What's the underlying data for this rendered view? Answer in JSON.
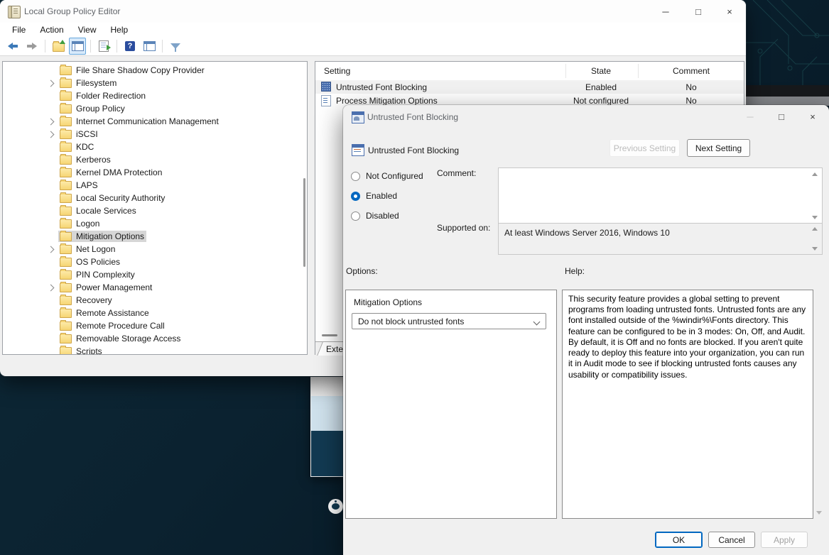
{
  "window": {
    "title": "Local Group Policy Editor",
    "menu": [
      "File",
      "Action",
      "View",
      "Help"
    ],
    "toolbar_icons": [
      "back",
      "forward",
      "up-one-level",
      "console-tree-active",
      "export-list",
      "help",
      "show-console",
      "filter"
    ],
    "tree": {
      "items": [
        {
          "label": "File Share Shadow Copy Provider",
          "expandable": false,
          "selected": false
        },
        {
          "label": "Filesystem",
          "expandable": true,
          "selected": false
        },
        {
          "label": "Folder Redirection",
          "expandable": false,
          "selected": false
        },
        {
          "label": "Group Policy",
          "expandable": false,
          "selected": false
        },
        {
          "label": "Internet Communication Management",
          "expandable": true,
          "selected": false
        },
        {
          "label": "iSCSI",
          "expandable": true,
          "selected": false
        },
        {
          "label": "KDC",
          "expandable": false,
          "selected": false
        },
        {
          "label": "Kerberos",
          "expandable": false,
          "selected": false
        },
        {
          "label": "Kernel DMA Protection",
          "expandable": false,
          "selected": false
        },
        {
          "label": "LAPS",
          "expandable": false,
          "selected": false
        },
        {
          "label": "Local Security Authority",
          "expandable": false,
          "selected": false
        },
        {
          "label": "Locale Services",
          "expandable": false,
          "selected": false
        },
        {
          "label": "Logon",
          "expandable": false,
          "selected": false
        },
        {
          "label": "Mitigation Options",
          "expandable": false,
          "selected": true
        },
        {
          "label": "Net Logon",
          "expandable": true,
          "selected": false
        },
        {
          "label": "OS Policies",
          "expandable": false,
          "selected": false
        },
        {
          "label": "PIN Complexity",
          "expandable": false,
          "selected": false
        },
        {
          "label": "Power Management",
          "expandable": true,
          "selected": false
        },
        {
          "label": "Recovery",
          "expandable": false,
          "selected": false
        },
        {
          "label": "Remote Assistance",
          "expandable": false,
          "selected": false
        },
        {
          "label": "Remote Procedure Call",
          "expandable": false,
          "selected": false
        },
        {
          "label": "Removable Storage Access",
          "expandable": false,
          "selected": false
        },
        {
          "label": "Scripts",
          "expandable": false,
          "selected": false
        }
      ]
    },
    "list": {
      "columns": [
        "Setting",
        "State",
        "Comment"
      ],
      "rows": [
        {
          "setting": "Untrusted Font Blocking",
          "state": "Enabled",
          "comment": "No",
          "icon": "admx-dotted",
          "highlighted": true
        },
        {
          "setting": "Process Mitigation Options",
          "state": "Not configured",
          "comment": "No",
          "icon": "list-doc",
          "highlighted": false
        }
      ],
      "bottom_tab": "Exter"
    }
  },
  "dialog": {
    "title": "Untrusted Font Blocking",
    "setting_name": "Untrusted Font Blocking",
    "previous_button": "Previous Setting",
    "next_button": "Next Setting",
    "radios": [
      {
        "label": "Not Configured",
        "selected": false
      },
      {
        "label": "Enabled",
        "selected": true
      },
      {
        "label": "Disabled",
        "selected": false
      }
    ],
    "comment_label": "Comment:",
    "comment_value": "",
    "supported_label": "Supported on:",
    "supported_value": "At least Windows Server 2016, Windows 10",
    "options_label": "Options:",
    "help_label": "Help:",
    "options_group": {
      "label": "Mitigation Options",
      "dropdown_value": "Do not block untrusted fonts"
    },
    "help_text": "This security feature provides a global setting to prevent programs from loading untrusted fonts. Untrusted fonts are any font installed outside of the %windir%\\Fonts directory. This feature can be configured to be in 3 modes: On, Off, and Audit. By default, it is Off and no fonts are blocked. If you aren't quite ready to deploy this feature into your organization, you can run it in Audit mode to see if blocking untrusted fonts causes any usability or compatibility issues.",
    "ok_button": "OK",
    "cancel_button": "Cancel",
    "apply_button": "Apply"
  },
  "colors": {
    "accent_blue": "#0067c0",
    "desktop_teal": "#0b2230",
    "selection_gray": "#d6d6d6",
    "dialog_bg": "#f0f0f0",
    "folder_yellow": "#f6d574"
  }
}
